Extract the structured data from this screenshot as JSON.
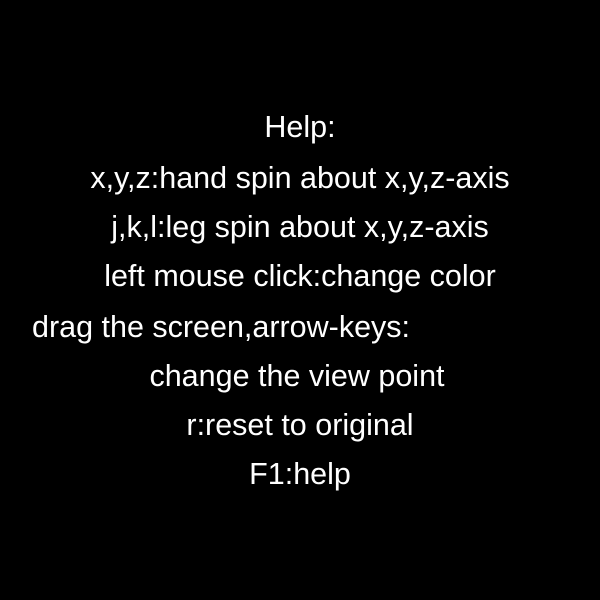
{
  "background_color": "#000000",
  "text_color": "#ffffff",
  "help": {
    "title": "Help:",
    "lines": [
      "x,y,z:hand spin about x,y,z-axis",
      "j,k,l:leg spin about x,y,z-axis",
      "left mouse click:change color",
      "drag the screen,arrow-keys:",
      "change the view point",
      "r:reset to original",
      "F1:help"
    ]
  }
}
